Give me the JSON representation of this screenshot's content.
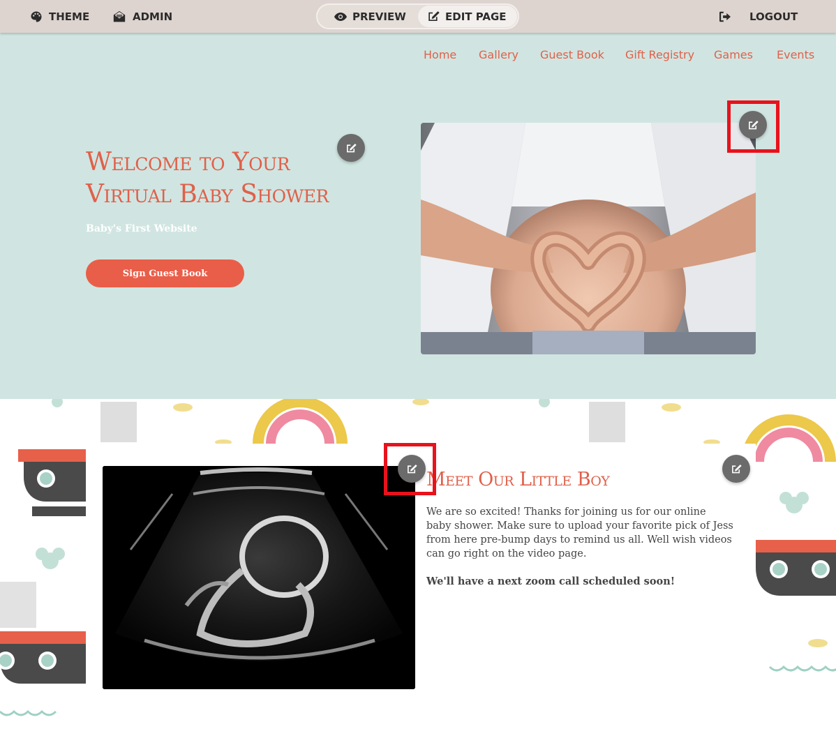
{
  "toolbar": {
    "theme_label": "THEME",
    "admin_label": "ADMIN",
    "preview_label": "PREVIEW",
    "edit_page_label": "EDIT PAGE",
    "logout_label": "LOGOUT",
    "active_mode": "EDIT PAGE"
  },
  "nav": {
    "items": [
      "Home",
      "Gallery",
      "Guest Book",
      "Gift Registry",
      "Games",
      "Events"
    ]
  },
  "hero": {
    "title": "Welcome to Your Virtual Baby Shower",
    "subtitle": "Baby's First Website",
    "button_label": "Sign Guest Book",
    "image_alt": "couple-hands-heart-on-belly-photo"
  },
  "about": {
    "title": "Meet Our Little Boy",
    "paragraph": "We are so excited! Thanks for joining us for our online baby shower.   Make sure to upload your favorite pick of Jess from here pre-bump days to remind us all. Well wish videos can go right on the video page.",
    "bold_line": "We'll have a next zoom call scheduled soon!",
    "image_alt": "ultrasound-image"
  },
  "icons": {
    "theme": "palette-icon",
    "admin": "envelope-open-icon",
    "preview": "eye-icon",
    "edit_page": "edit-icon",
    "logout": "sign-out-icon",
    "edit_fab": "edit-icon"
  },
  "colors": {
    "toolbar_bg": "#ddd4cf",
    "hero_bg": "#d0e5e1",
    "accent": "#e0604a",
    "button": "#e95e49",
    "edit_fab": "#6b6b6b",
    "highlight": "#e8121c"
  }
}
